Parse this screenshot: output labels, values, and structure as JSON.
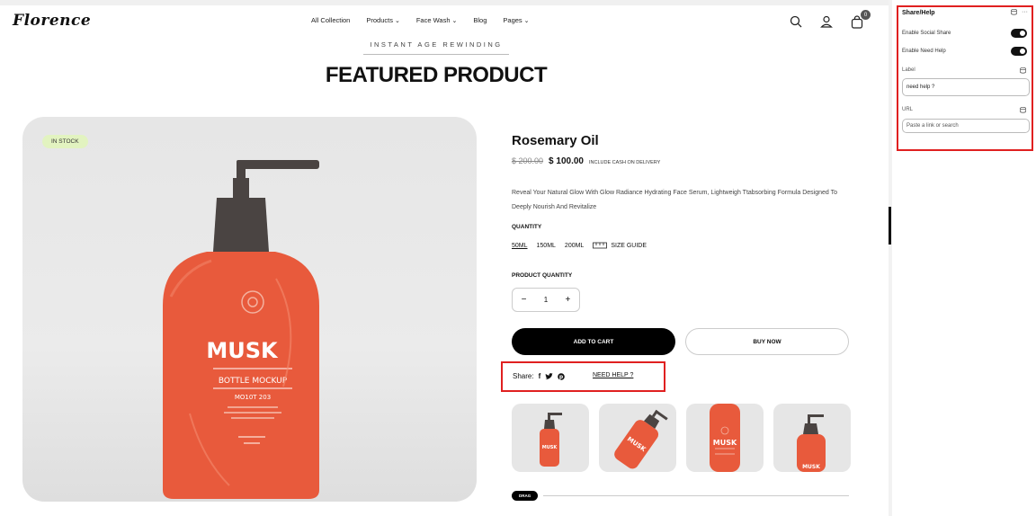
{
  "header": {
    "logo": "Florence",
    "nav": [
      {
        "label": "All Collection",
        "dropdown": false
      },
      {
        "label": "Products",
        "dropdown": true
      },
      {
        "label": "Face Wash",
        "dropdown": true
      },
      {
        "label": "Blog",
        "dropdown": false
      },
      {
        "label": "Pages",
        "dropdown": true
      }
    ],
    "icons": [
      "search-icon",
      "user-icon",
      "cart-icon"
    ],
    "cart_count": "0"
  },
  "hero": {
    "eyebrow": "INSTANT AGE REWINDING",
    "title": "FEATURED PRODUCT"
  },
  "product": {
    "stock_badge": "IN STOCK",
    "image_brand": "MUSK",
    "image_subtitle": "BOTTLE MOCKUP",
    "image_code": "MO10T 203",
    "name": "Rosemary Oil",
    "old_price": "$ 200.00",
    "price": "$ 100.00",
    "price_note": "INCLUDE CASH ON DELIVERY",
    "description": "Reveal Your Natural Glow With Glow Radiance Hydrating Face Serum, Lightweigh Ttabsorbing Formula Designed To Deeply Nourish And Revitalize",
    "quantity_label": "QUANTITY",
    "sizes": [
      "50ML",
      "150ML",
      "200ML"
    ],
    "selected_size": "50ML",
    "size_guide": "SIZE GUIDE",
    "product_quantity_label": "PRODUCT QUANTITY",
    "quantity": "1",
    "minus": "−",
    "plus": "+",
    "add_to_cart": "ADD TO CART",
    "buy_now": "BUY NOW",
    "share_label": "Share:",
    "share_icons": [
      "facebook-icon",
      "twitter-icon",
      "pinterest-icon"
    ],
    "need_help": "NEED HELP ?",
    "drag_label": "DRAG"
  },
  "panel": {
    "title": "Share/Help",
    "enable_social_share": "Enable Social Share",
    "enable_need_help": "Enable Need Help",
    "social_share_on": true,
    "need_help_on": true,
    "label_title": "Label",
    "label_value": "need help ?",
    "url_title": "URL",
    "url_placeholder": "Paste a link or search"
  },
  "colors": {
    "bottle": "#e85a3c",
    "cap": "#4a4442",
    "highlight_box": "#e02020",
    "stock_badge": "#e2f3c0"
  }
}
